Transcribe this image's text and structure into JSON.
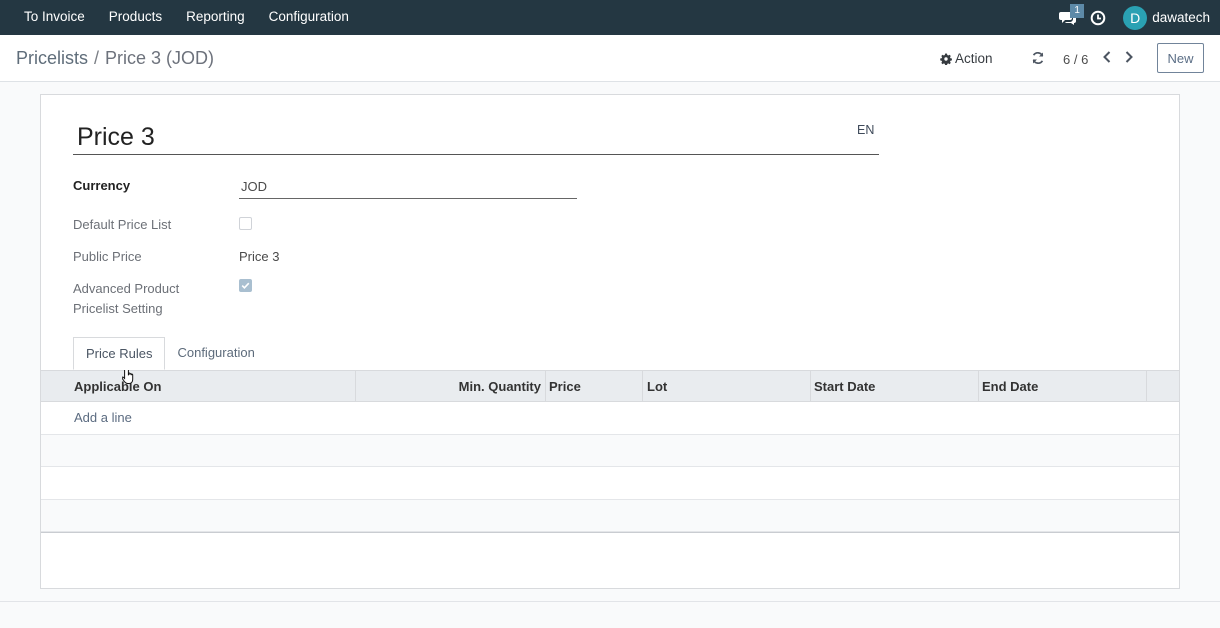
{
  "navbar": {
    "menu": [
      "To Invoice",
      "Products",
      "Reporting",
      "Configuration"
    ],
    "chat_count": "1",
    "user_initial": "D",
    "user_name": "dawatech",
    "bg_color": "#243742"
  },
  "control_panel": {
    "breadcrumb_parent": "Pricelists",
    "breadcrumb_separator": "/",
    "breadcrumb_current": "Price 3 (JOD)",
    "action_label": "Action",
    "pager": "6 / 6",
    "new_label": "New"
  },
  "form": {
    "name": "Price 3",
    "lang": "EN",
    "currency_label": "Currency",
    "currency_value": "JOD",
    "default_pricelist_label": "Default Price List",
    "default_pricelist_checked": false,
    "public_price_label": "Public Price",
    "public_price_value": "Price 3",
    "advanced_setting_label_1": "Advanced Product",
    "advanced_setting_label_2": "Pricelist Setting",
    "advanced_setting_checked": true
  },
  "tabs": [
    {
      "label": "Price Rules",
      "active": true
    },
    {
      "label": "Configuration",
      "active": false
    }
  ],
  "table": {
    "columns": [
      "Applicable On",
      "Min. Quantity",
      "Price",
      "Lot",
      "Start Date",
      "End Date"
    ],
    "add_line_label": "Add a line"
  },
  "icons": {
    "chat": "chat-icon",
    "clock": "clock-icon",
    "gear": "gear-icon",
    "refresh": "refresh-icon",
    "prev": "chevron-left-icon",
    "next": "chevron-right-icon",
    "checkbox": "checkmark-icon"
  },
  "colors": {
    "navbar": "#243742",
    "accent": "#71849a",
    "avatar": "#2aa1b3"
  }
}
